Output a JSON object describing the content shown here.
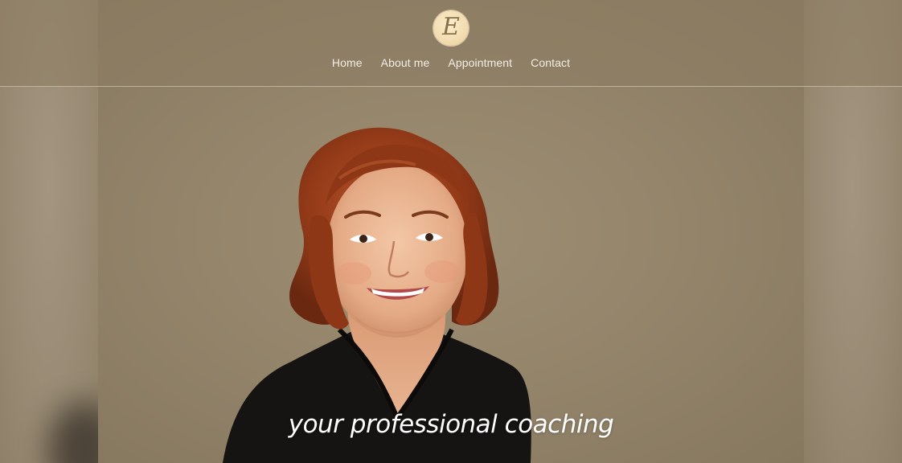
{
  "header": {
    "logo_letter": "E",
    "nav": [
      {
        "label": "Home"
      },
      {
        "label": "About me"
      },
      {
        "label": "Appointment"
      },
      {
        "label": "Contact"
      }
    ]
  },
  "hero": {
    "tagline": "your professional coaching",
    "image": "portrait-photo"
  },
  "colors": {
    "background": "#8b7d64",
    "header_overlay": "#8c7c62",
    "logo_fill": "#f2dcb0",
    "logo_letter": "#8a6f47",
    "nav_text": "#f4efe6",
    "tagline_text": "#ffffff",
    "hair": "#9a3f1c",
    "shirt": "#161412"
  }
}
